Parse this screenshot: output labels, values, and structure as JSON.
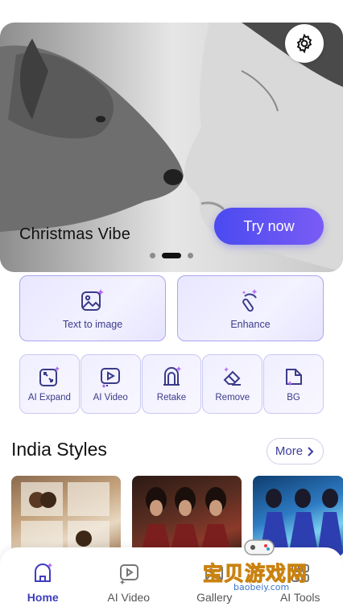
{
  "banner": {
    "title": "Christmas Vibe",
    "cta_label": "Try now",
    "dots": 3,
    "active_dot": 1
  },
  "primary_tools": [
    {
      "label": "Text to image",
      "icon": "image-sparkle-icon"
    },
    {
      "label": "Enhance",
      "icon": "magic-wand-icon"
    }
  ],
  "secondary_tools": [
    {
      "label": "AI Expand",
      "icon": "expand-icon"
    },
    {
      "label": "AI Video",
      "icon": "video-play-icon"
    },
    {
      "label": "Retake",
      "icon": "retake-icon"
    },
    {
      "label": "Remove",
      "icon": "eraser-icon"
    },
    {
      "label": "BG",
      "icon": "background-icon"
    }
  ],
  "section": {
    "title": "India Styles",
    "more_label": "More"
  },
  "bottom_nav": [
    {
      "label": "Home",
      "icon": "home-icon",
      "active": true
    },
    {
      "label": "AI Video",
      "icon": "video-icon",
      "active": false
    },
    {
      "label": "Gallery",
      "icon": "gallery-icon",
      "active": false
    },
    {
      "label": "AI Tools",
      "icon": "tools-icon",
      "active": false
    }
  ],
  "watermark": {
    "text": "宝贝游戏网",
    "url": "baobeiy.com"
  },
  "colors": {
    "accent": "#4a4af0",
    "card_border": "#a9a6f0",
    "icon_purple": "#3b3b8a",
    "sparkle": "#b06af0"
  }
}
